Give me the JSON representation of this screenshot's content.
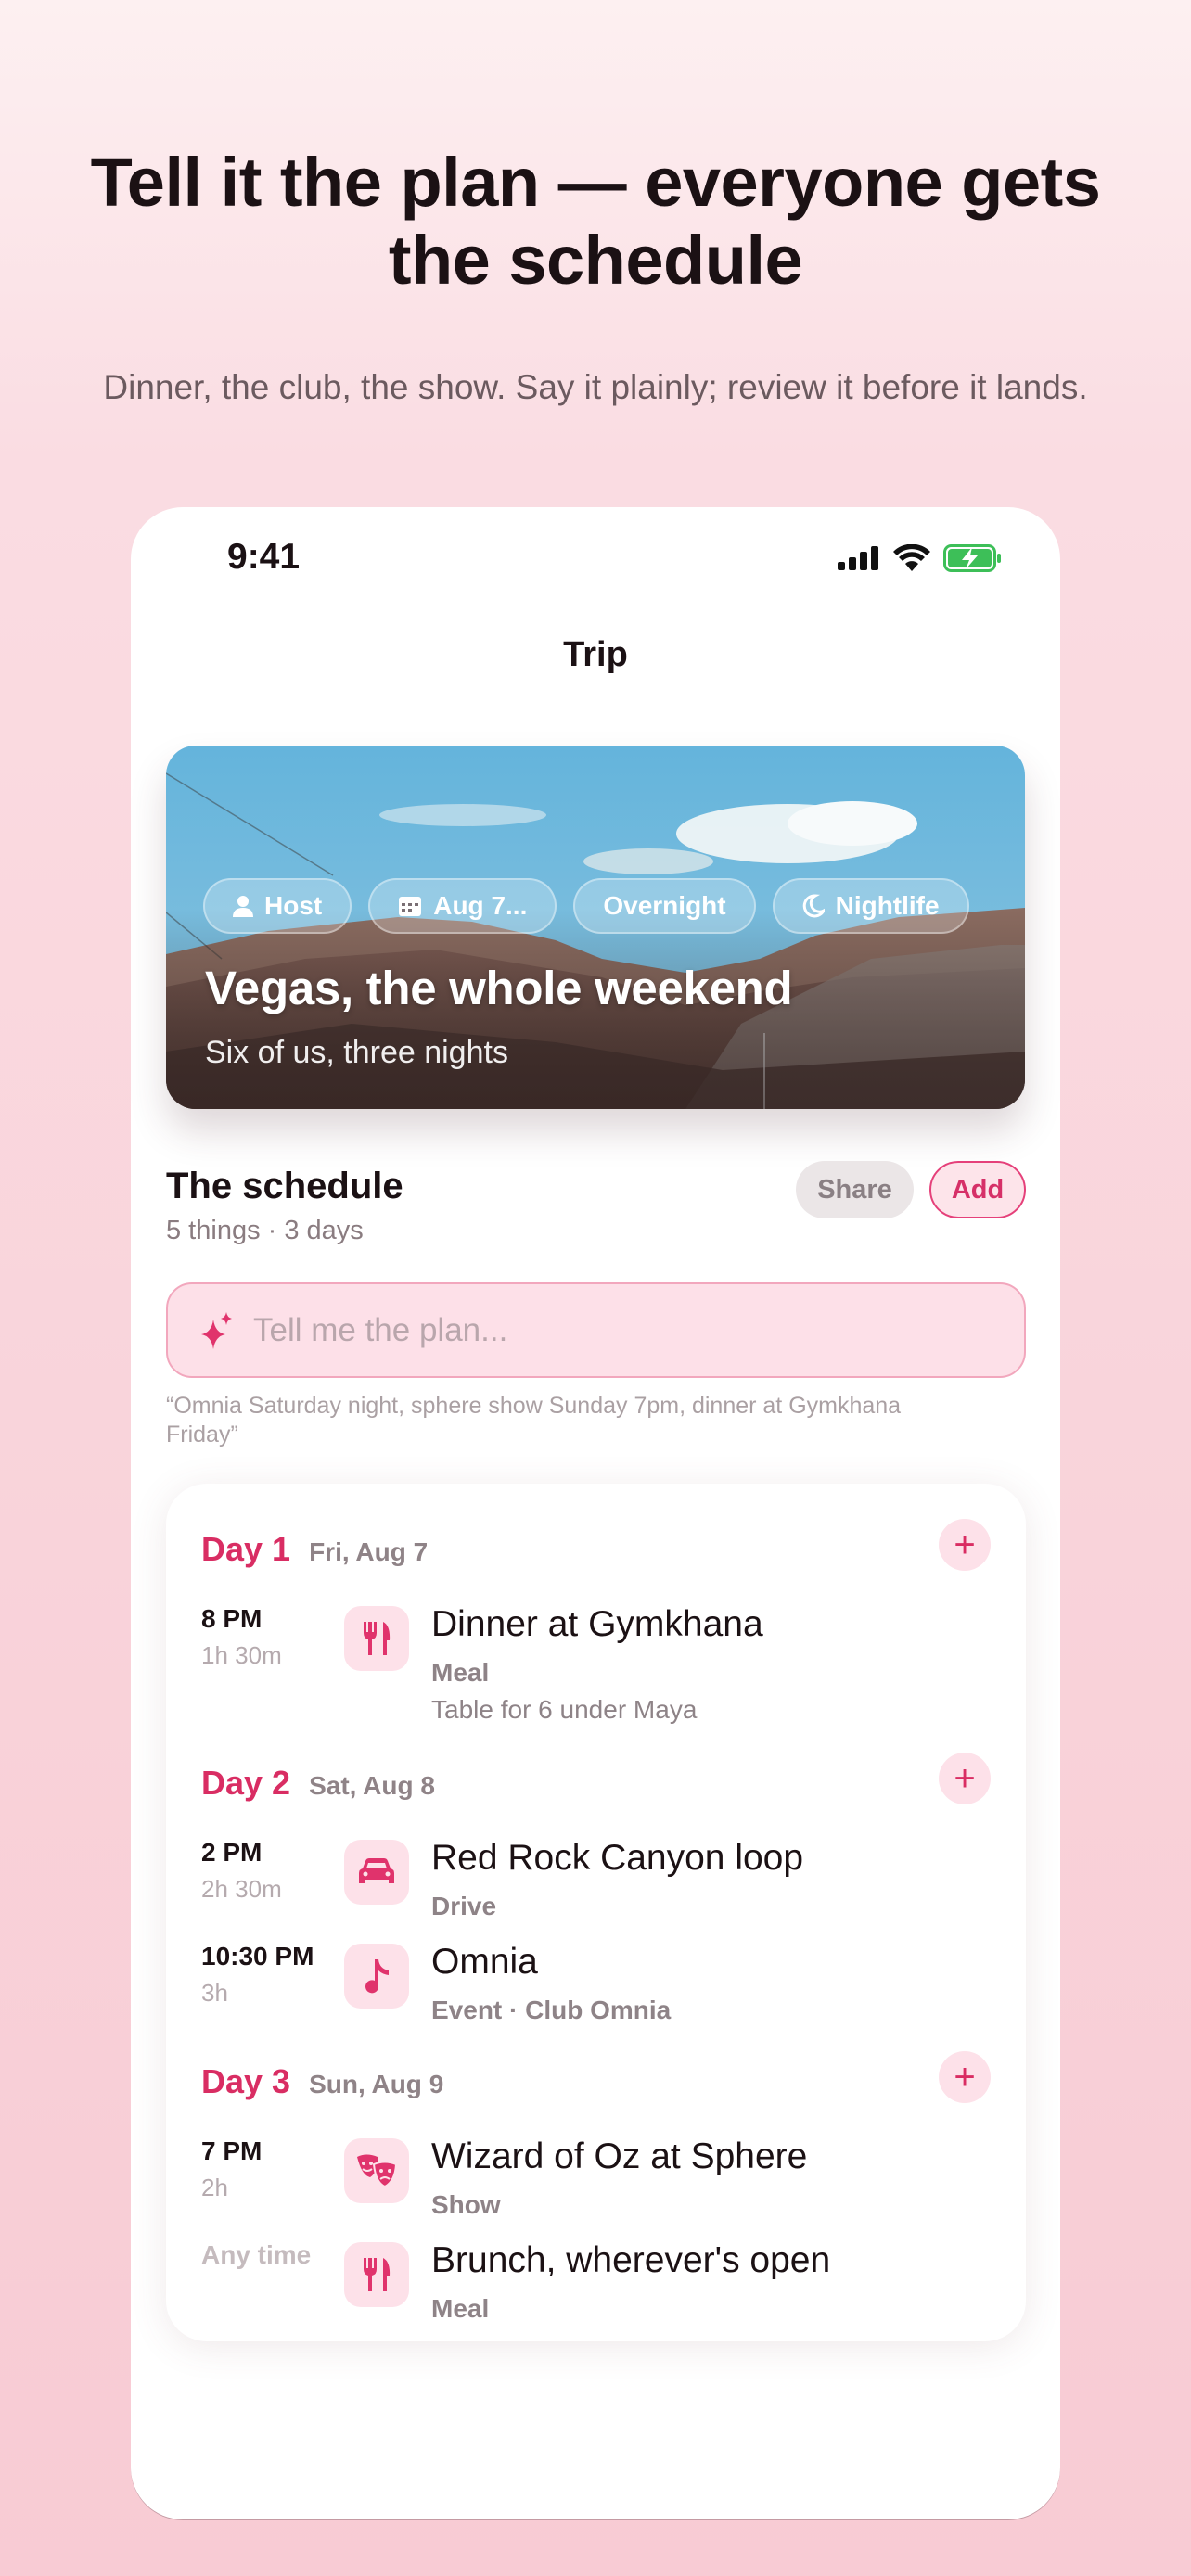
{
  "headline": "Tell it the plan — everyone gets the schedule",
  "subhead": "Dinner, the club, the show. Say it plainly; review it before it lands.",
  "status_bar": {
    "time": "9:41"
  },
  "nav": {
    "title": "Trip"
  },
  "hero": {
    "chips": [
      {
        "icon": "person-icon",
        "label": "Host"
      },
      {
        "icon": "calendar-icon",
        "label": "Aug 7..."
      },
      {
        "icon": "",
        "label": "Overnight"
      },
      {
        "icon": "moon-icon",
        "label": "Nightlife"
      }
    ],
    "title": "Vegas, the whole weekend",
    "subtitle": "Six of us, three nights"
  },
  "schedule": {
    "title": "The schedule",
    "meta": "5 things · 3 days",
    "share_label": "Share",
    "add_label": "Add",
    "input_placeholder": "Tell me the plan...",
    "hint": "“Omnia Saturday night, sphere show Sunday 7pm, dinner at Gymkhana Friday”"
  },
  "days": [
    {
      "label": "Day 1",
      "date": "Fri, Aug 7",
      "items": [
        {
          "time": "8 PM",
          "duration": "1h 30m",
          "icon": "fork-knife-icon",
          "title": "Dinner at Gymkhana",
          "subtitle": "Meal",
          "note": "Table for 6 under Maya"
        }
      ]
    },
    {
      "label": "Day 2",
      "date": "Sat, Aug 8",
      "items": [
        {
          "time": "2 PM",
          "duration": "2h 30m",
          "icon": "car-icon",
          "title": "Red Rock Canyon loop",
          "subtitle": "Drive"
        },
        {
          "time": "10:30 PM",
          "duration": "3h",
          "icon": "music-note-icon",
          "title": "Omnia",
          "subtitle": "Event · Club Omnia"
        }
      ]
    },
    {
      "label": "Day 3",
      "date": "Sun, Aug 9",
      "items": [
        {
          "time": "7 PM",
          "duration": "2h",
          "icon": "theater-masks-icon",
          "title": "Wizard of Oz at Sphere",
          "subtitle": "Show"
        },
        {
          "time": "Any time",
          "duration": "",
          "icon": "fork-knife-icon",
          "title": "Brunch, wherever's open",
          "subtitle": "Meal"
        }
      ]
    }
  ],
  "colors": {
    "accent": "#d92d63",
    "accent_bg": "#fde1e9"
  }
}
